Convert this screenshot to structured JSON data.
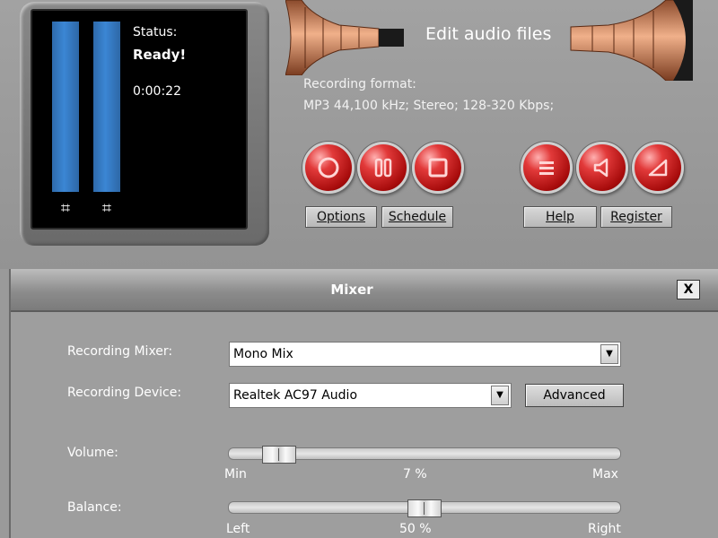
{
  "display": {
    "status_label": "Status:",
    "status_value": "Ready!",
    "elapsed_time": "0:00:22"
  },
  "header": {
    "edit_label": "Edit audio files"
  },
  "recording": {
    "format_label": "Recording format:",
    "format_value": "MP3 44,100 kHz; Stereo;  128-320 Kbps;"
  },
  "buttons": {
    "options": "Options",
    "schedule": "Schedule",
    "help": "Help",
    "register": "Register"
  },
  "mixer": {
    "title": "Mixer",
    "close": "X",
    "recording_mixer_label": "Recording Mixer:",
    "recording_mixer_value": "Mono Mix",
    "recording_device_label": "Recording Device:",
    "recording_device_value": "Realtek AC97 Audio",
    "advanced": "Advanced",
    "volume": {
      "label": "Volume:",
      "min": "Min",
      "value_text": "7 %",
      "max": "Max",
      "value": 0.07
    },
    "balance": {
      "label": "Balance:",
      "left": "Left",
      "value_text": "50 %",
      "right": "Right",
      "value": 0.5
    }
  },
  "colors": {
    "button_red": "#c81616",
    "meter_blue": "#3b86d4",
    "horn_copper": "#c9764a"
  },
  "icons": [
    "record-icon",
    "pause-icon",
    "stop-icon",
    "menu-icon",
    "speaker-icon",
    "volume-ramp-icon"
  ]
}
